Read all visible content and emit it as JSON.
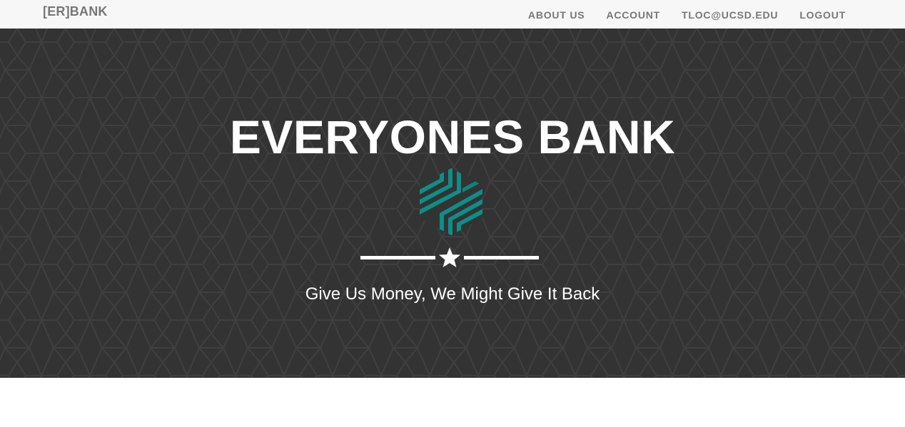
{
  "navbar": {
    "brand": "[ER]BANK",
    "links": [
      {
        "label": "ABOUT US"
      },
      {
        "label": "ACCOUNT"
      },
      {
        "label": "TLOC@UCSD.EDU"
      },
      {
        "label": "LOGOUT"
      }
    ]
  },
  "hero": {
    "title": "EVERYONES BANK",
    "tagline": "Give Us Money, We Might Give It Back",
    "logo_icon": "bank-logo-hexagon-icon",
    "divider_icon": "star-icon"
  },
  "colors": {
    "navbar_bg": "#f7f7f7",
    "nav_text": "#777777",
    "hero_bg": "#333333",
    "logo_teal": "#0c8f88",
    "text_white": "#ffffff"
  }
}
